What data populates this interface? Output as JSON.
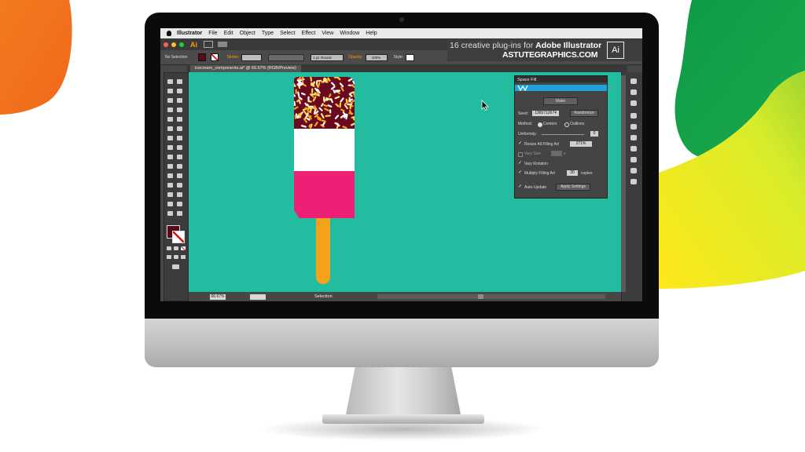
{
  "menubar": {
    "app_name": "Illustrator",
    "items": [
      "File",
      "Edit",
      "Object",
      "Type",
      "Select",
      "Effect",
      "View",
      "Window",
      "Help"
    ]
  },
  "app_bar": {
    "logo": "Ai"
  },
  "control_bar": {
    "selection_label": "No Selection",
    "stroke_label": "Stroke:",
    "stroke_weight": "1 pt. Round",
    "opacity_label": "Opacity:",
    "opacity_value": "100%",
    "style_label": "Style:"
  },
  "banner": {
    "line1_prefix": "16 creative plug-ins for",
    "line1_bold": "Adobe Illustrator",
    "line2": "ASTUTEGRAPHICS.COM",
    "logo": "Ai"
  },
  "document_tab": {
    "label": "icecream_components.ai* @ 66.67% (RGB/Preview)"
  },
  "statusbar": {
    "zoom": "66.67%",
    "status": "Selection"
  },
  "space_fill": {
    "title": "Space Fill",
    "make_label": "Make",
    "seed_label": "Seed:",
    "seed_value": "1365712674",
    "randomize_label": "Randomize",
    "method_label": "Method:",
    "method_centers": "Centers",
    "method_outlines": "Outlines",
    "uniformity_label": "Uniformity:",
    "uniformity_value": "0",
    "resize_label": "Resize All Filling Art",
    "resize_value": "271%",
    "vary_size_label": "Vary Size",
    "vary_size_suffix": "x",
    "vary_rotation_label": "Vary Rotation",
    "multiply_label": "Multiply Filling Art",
    "multiply_value": "30",
    "copies_label": "copies",
    "auto_update_label": "Auto-Update",
    "apply_label": "Apply Settings"
  },
  "colors": {
    "canvas": "#24bca1",
    "ice_dark": "#6a0a1e",
    "ice_pink": "#ec2176",
    "ice_white": "#ffffff",
    "stick": "#f4a21c",
    "accent_orange": "#ff9a00",
    "panel_blue": "#1fa3d8",
    "fill_swatch": "#5a0a18"
  },
  "icons": [
    "apple-icon",
    "ai-logo-icon",
    "cursor-icon",
    "brush-icon"
  ]
}
